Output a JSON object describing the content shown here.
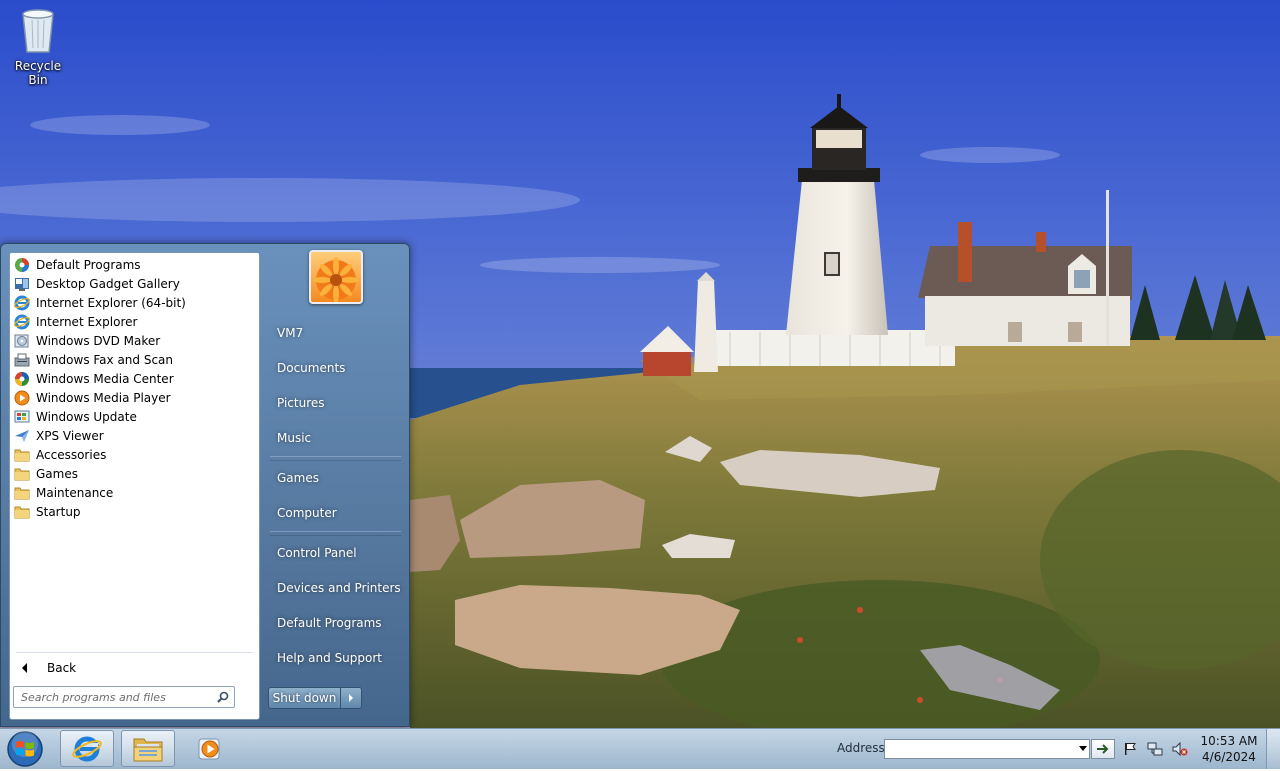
{
  "desktop": {
    "icons": [
      {
        "label": "Recycle Bin",
        "icon": "recycle-bin-icon"
      }
    ]
  },
  "start_menu": {
    "programs": [
      {
        "label": "Default Programs",
        "icon": "default-programs-icon"
      },
      {
        "label": "Desktop Gadget Gallery",
        "icon": "gadget-gallery-icon"
      },
      {
        "label": "Internet Explorer (64-bit)",
        "icon": "internet-explorer-icon"
      },
      {
        "label": "Internet Explorer",
        "icon": "internet-explorer-icon"
      },
      {
        "label": "Windows DVD Maker",
        "icon": "dvd-maker-icon"
      },
      {
        "label": "Windows Fax and Scan",
        "icon": "fax-scan-icon"
      },
      {
        "label": "Windows Media Center",
        "icon": "media-center-icon"
      },
      {
        "label": "Windows Media Player",
        "icon": "media-player-icon"
      },
      {
        "label": "Windows Update",
        "icon": "windows-update-icon"
      },
      {
        "label": "XPS Viewer",
        "icon": "xps-viewer-icon"
      },
      {
        "label": "Accessories",
        "icon": "folder-icon"
      },
      {
        "label": "Games",
        "icon": "folder-icon"
      },
      {
        "label": "Maintenance",
        "icon": "folder-icon"
      },
      {
        "label": "Startup",
        "icon": "folder-icon"
      }
    ],
    "back_label": "Back",
    "search_placeholder": "Search programs and files",
    "places": [
      "VM7",
      "Documents",
      "Pictures",
      "Music",
      "Games",
      "Computer",
      "Control Panel",
      "Devices and Printers",
      "Default Programs",
      "Help and Support"
    ],
    "shutdown_label": "Shut down"
  },
  "taskbar": {
    "pinned": [
      {
        "name": "internet-explorer",
        "icon": "internet-explorer-icon"
      },
      {
        "name": "windows-explorer",
        "icon": "folder-icon"
      },
      {
        "name": "windows-media-player",
        "icon": "media-player-icon"
      }
    ],
    "address_label": "Address",
    "address_value": "",
    "clock": {
      "time": "10:53 AM",
      "date": "4/6/2024"
    }
  }
}
